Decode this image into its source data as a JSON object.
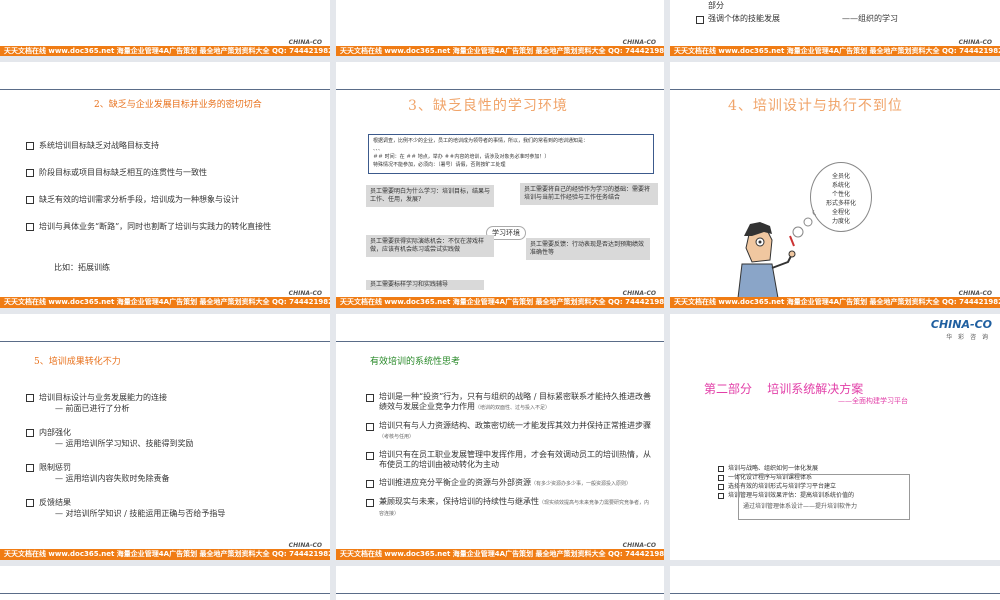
{
  "brand": {
    "footer_text": "天天文档在线  www.doc365.net  海量企业管理4A广告策划 最全地产策划资料大全  QQ: 744421982",
    "logo": "CHINA-CO"
  },
  "slide_top_right": {
    "line1": "部分",
    "line2_left": "强调个体的技能发展",
    "line2_right": "——组织的学习"
  },
  "slide_goal": {
    "title": "2、缺乏与企业发展目标并业务的密切切合",
    "bullets": [
      "系统培训目标缺乏对战略目标支持",
      "阶段目标或项目目标缺乏相互的连贯性与一致性",
      "缺乏有效的培训需求分析手段，培训成为一种想象与设计",
      "培训与具体业务“断路”，同时也割断了培训与实践力的转化直接性"
    ],
    "example": "比如：拓展训练"
  },
  "slide_env": {
    "title": "3、缺乏良性的学习环境",
    "notice_line1": "根据调查，比例不少的企业，员工的培训成为领导者的事情，所以，我们的常看到的培训通知是：",
    "notice_line2": "、、、",
    "notice_line3": "＃＃ 时间：在 ＃＃ 地点，举办 ＃＃内容的培训，请涉及对象务必准时参加！）",
    "notice_line4": "特殊情况不能参加，必须向：（署号）请假，否则按旷工处理",
    "center": "学习环境",
    "box_tl": "员工需要明白为什么学习：培训目标，结果与工作、任用，发展?",
    "box_tr": "员工需要将自己的经验作为学习的基础：需要将培训与当前工作经验与工作任务结合",
    "box_ml": "员工需要获得实际演练机会：不仅在游戏样做，应该有机会练习或尝试实践做",
    "box_mr": "员工需要反馈：行动表现是否达到预期绩效准确性等",
    "box_bl": "员工需要标样学习和实践辅导"
  },
  "slide_exec": {
    "title": "4、培训设计与执行不到位",
    "bubble": [
      "全员化",
      "系统化",
      "个性化",
      "形式多样化",
      "全程化",
      "力度化"
    ]
  },
  "slide_result": {
    "title": "5、培训成果转化不力",
    "items": [
      {
        "head": "培训目标设计与业务发展能力的连接",
        "sub": "— 前面已进行了分析"
      },
      {
        "head": "内部强化",
        "sub": "— 运用培训所学习知识、技能得到奖励"
      },
      {
        "head": "限制惩罚",
        "sub": "— 运用培训内容失败时免除责备"
      },
      {
        "head": "反馈结果",
        "sub": "— 对培训所学知识 / 技能运用正确与否给予指导"
      }
    ]
  },
  "slide_think": {
    "title": "有效培训的系统性思考",
    "bullets": [
      {
        "text": "培训是一种“投资”行为，只有与组织的战略 / 目标紧密联系才能持久推进改善绩效与发展企业竞争力作用",
        "note": "（培训的双面性、过与投入不足）"
      },
      {
        "text": "培训只有与人力资源结构、政策密切统一才能发挥其效力并保持正常推进步骤",
        "note": "（考核与任用）"
      },
      {
        "text": "培训只有在员工职业发展管理中发挥作用，才会有效调动员工的培训热情，从布使员工的培训由被动转化为主动",
        "note": ""
      },
      {
        "text": "培训推进应充分平衡企业的资源与外部资源",
        "note": "（有多少资源办多少事，一般资源投入原则）"
      },
      {
        "text": "兼顾现实与未来，保持培训的持续性与继承性",
        "note": "（现实绩效提高与未来竞争力需要研究竞争者，内容连接）"
      }
    ]
  },
  "slide_part2": {
    "logo_sub": "华 彩 咨 询",
    "title": "第二部分    培训系统解决方案",
    "subtitle": "——全面构建学习平台",
    "bullets": [
      "培训与战略、组织如何一体化发展",
      "一体化设计程序与培训课程体系",
      "选择有效的培训形式与培训学习平台建立",
      "培训管理与培训效果评估：提高培训系统价值的"
    ],
    "overlay": "通过培训管理体系设计——提升培训软件力"
  }
}
